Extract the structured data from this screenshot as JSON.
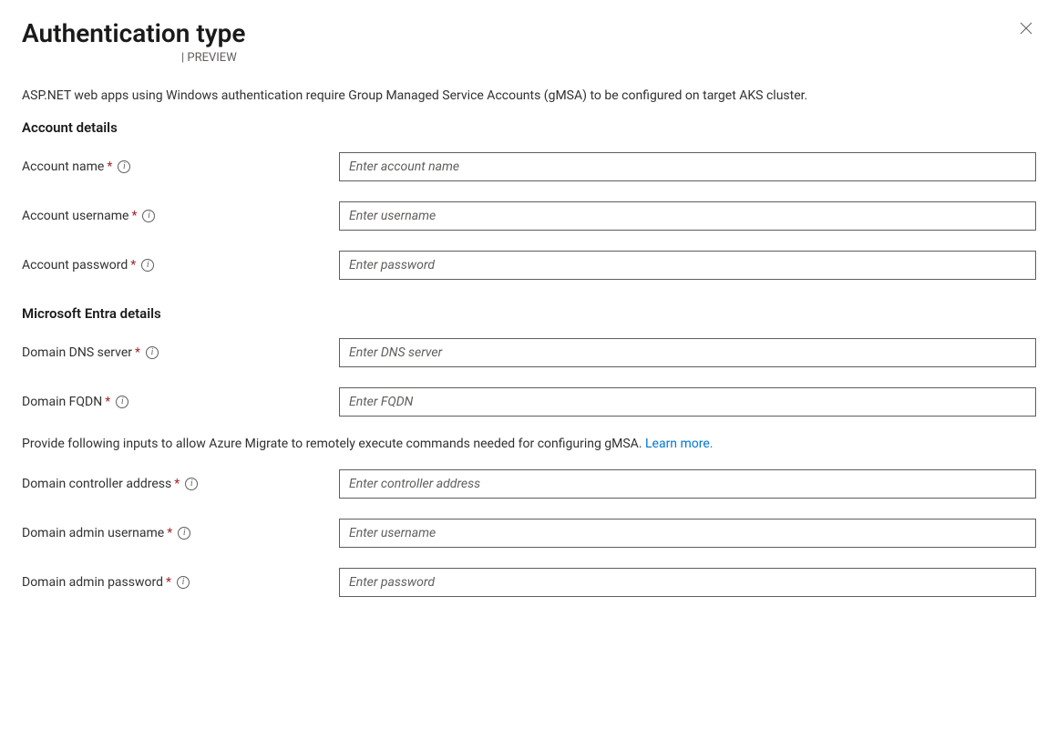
{
  "header": {
    "title": "Authentication type",
    "badge": "| PREVIEW"
  },
  "intro": "ASP.NET web apps using Windows authentication require Group Managed Service Accounts (gMSA) to be configured on target AKS cluster.",
  "sections": {
    "account": {
      "heading": "Account details",
      "fields": {
        "name": {
          "label": "Account name",
          "placeholder": "Enter account name"
        },
        "username": {
          "label": "Account username",
          "placeholder": "Enter username"
        },
        "password": {
          "label": "Account password",
          "placeholder": "Enter password"
        }
      }
    },
    "entra": {
      "heading": "Microsoft Entra details",
      "fields": {
        "dns": {
          "label": "Domain DNS server",
          "placeholder": "Enter DNS server"
        },
        "fqdn": {
          "label": "Domain FQDN",
          "placeholder": "Enter FQDN"
        },
        "controller": {
          "label": "Domain controller address",
          "placeholder": "Enter controller address"
        },
        "adminUser": {
          "label": "Domain admin username",
          "placeholder": "Enter username"
        },
        "adminPass": {
          "label": "Domain admin password",
          "placeholder": "Enter password"
        }
      },
      "helper": "Provide following inputs to allow Azure Migrate to remotely execute commands needed for configuring gMSA. ",
      "learnMore": "Learn more."
    }
  },
  "glyphs": {
    "required": "*",
    "info": "i"
  }
}
